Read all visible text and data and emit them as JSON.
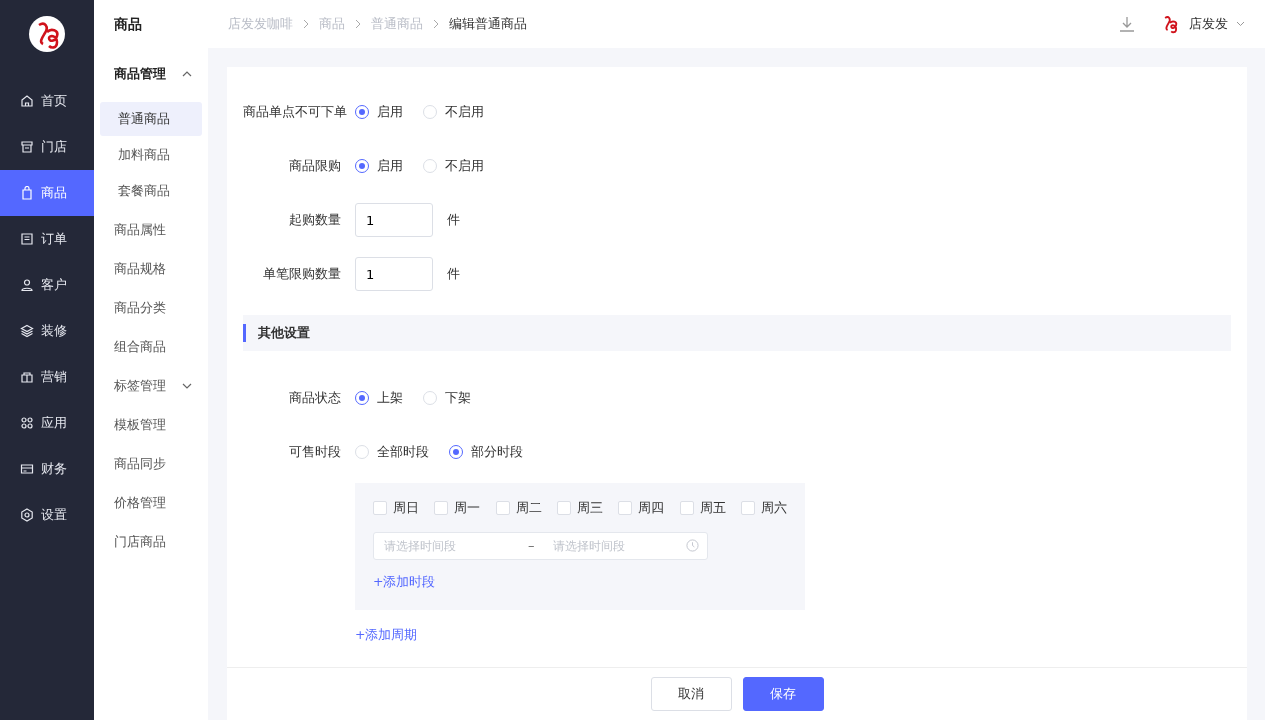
{
  "nav": {
    "items": [
      {
        "label": "首页",
        "selected": false
      },
      {
        "label": "门店",
        "selected": false
      },
      {
        "label": "商品",
        "selected": true
      },
      {
        "label": "订单",
        "selected": false
      },
      {
        "label": "客户",
        "selected": false
      },
      {
        "label": "装修",
        "selected": false
      },
      {
        "label": "营销",
        "selected": false
      },
      {
        "label": "应用",
        "selected": false
      },
      {
        "label": "财务",
        "selected": false
      },
      {
        "label": "设置",
        "selected": false
      }
    ]
  },
  "submenu": {
    "title": "商品",
    "items": [
      {
        "label": "商品管理",
        "expanded": true,
        "children": [
          {
            "label": "普通商品",
            "selected": true
          },
          {
            "label": "加料商品",
            "selected": false
          },
          {
            "label": "套餐商品",
            "selected": false
          }
        ]
      },
      {
        "label": "商品属性"
      },
      {
        "label": "商品规格"
      },
      {
        "label": "商品分类"
      },
      {
        "label": "组合商品"
      },
      {
        "label": "标签管理",
        "expanded": false
      },
      {
        "label": "模板管理"
      },
      {
        "label": "商品同步"
      },
      {
        "label": "价格管理"
      },
      {
        "label": "门店商品"
      }
    ]
  },
  "breadcrumb": [
    "店发发咖啡",
    "商品",
    "普通商品",
    "编辑普通商品"
  ],
  "header": {
    "user": "店发发"
  },
  "form": [
    {
      "kind": "radio",
      "label": "商品单点不可下单",
      "options": [
        {
          "label": "启用",
          "selected": true
        },
        {
          "label": "不启用",
          "selected": false
        }
      ]
    },
    {
      "kind": "radio",
      "label": "商品限购",
      "options": [
        {
          "label": "启用",
          "selected": true
        },
        {
          "label": "不启用",
          "selected": false
        }
      ]
    },
    {
      "kind": "number",
      "label": "起购数量",
      "value": "1",
      "unit": "件"
    },
    {
      "kind": "number",
      "label": "单笔限购数量",
      "value": "1",
      "unit": "件"
    },
    {
      "kind": "section",
      "label": "其他设置"
    },
    {
      "kind": "radio",
      "label": "商品状态",
      "options": [
        {
          "label": "上架",
          "selected": true
        },
        {
          "label": "下架",
          "selected": false
        }
      ]
    },
    {
      "kind": "radio",
      "label": "可售时段",
      "options": [
        {
          "label": "全部时段",
          "selected": false
        },
        {
          "label": "部分时段",
          "selected": true
        }
      ]
    },
    {
      "kind": "period",
      "days": [
        {
          "label": "周日",
          "checked": false
        },
        {
          "label": "周一",
          "checked": false
        },
        {
          "label": "周二",
          "checked": false
        },
        {
          "label": "周三",
          "checked": false
        },
        {
          "label": "周四",
          "checked": false
        },
        {
          "label": "周五",
          "checked": false
        },
        {
          "label": "周六",
          "checked": false
        }
      ],
      "start_placeholder": "请选择时间段",
      "separator": "–",
      "end_placeholder": "请选择时间段",
      "add_slot": "+添加时段"
    },
    {
      "kind": "link",
      "label": "+添加周期"
    }
  ],
  "footer": {
    "buttons": [
      {
        "label": "取消",
        "kind": "secondary"
      },
      {
        "label": "保存",
        "kind": "primary"
      }
    ]
  }
}
